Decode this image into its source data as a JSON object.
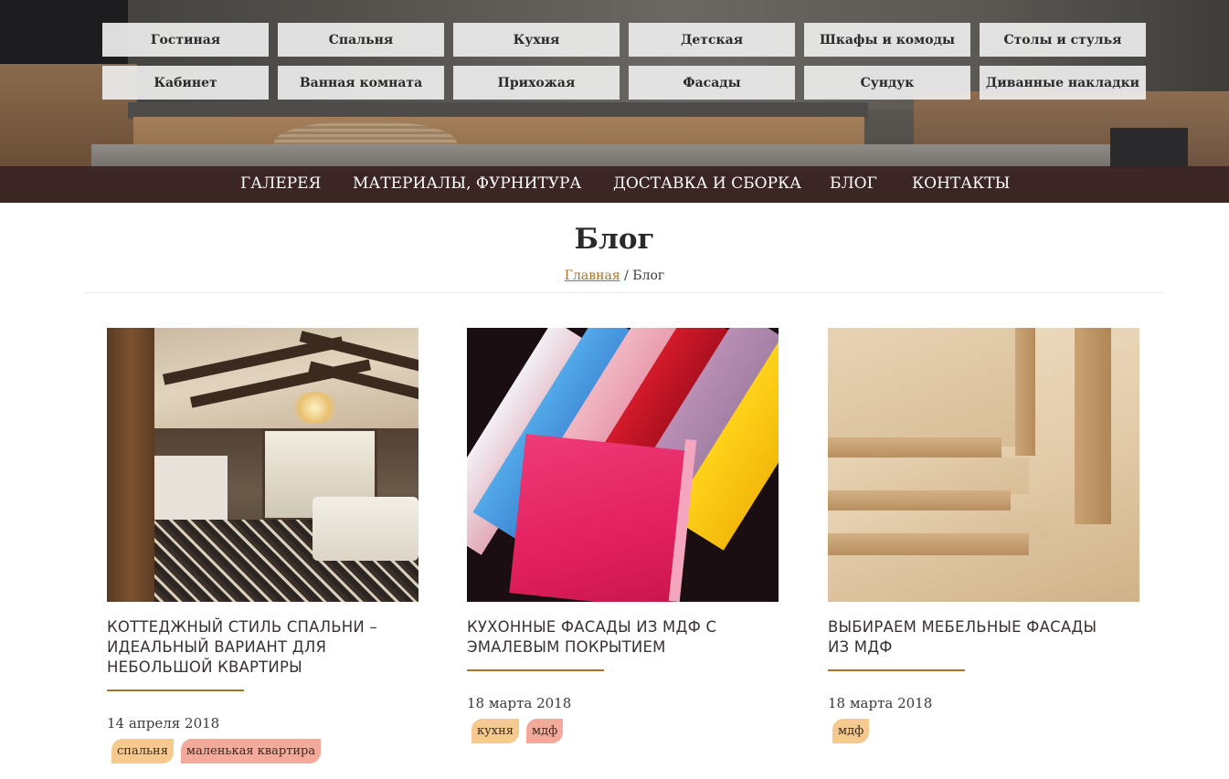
{
  "categories": [
    "Гостиная",
    "Спальня",
    "Кухня",
    "Детская",
    "Шкафы и комоды",
    "Столы и стулья",
    "Кабинет",
    "Ванная комната",
    "Прихожая",
    "Фасады",
    "Сундук",
    "Диванные накладки"
  ],
  "main_nav": [
    "ГАЛЕРЕЯ",
    "МАТЕРИАЛЫ, ФУРНИТУРА",
    "ДОСТАВКА И СБОРКА",
    "БЛОГ",
    "КОНТАКТЫ"
  ],
  "page": {
    "title": "Блог",
    "breadcrumb": {
      "home": "Главная",
      "separator": "/",
      "current": "Блог"
    }
  },
  "posts": [
    {
      "title": "КОТТЕДЖНЫЙ СТИЛЬ СПАЛЬНИ – ИДЕАЛЬНЫЙ ВАРИАНТ ДЛЯ НЕБОЛЬШОЙ КВАРТИРЫ",
      "date": "14 апреля 2018",
      "tags": [
        "спальня",
        "маленькая квартира"
      ]
    },
    {
      "title": "КУХОННЫЕ ФАСАДЫ ИЗ МДФ С ЭМАЛЕВЫМ ПОКРЫТИЕМ",
      "date": "18 марта 2018",
      "tags": [
        "кухня",
        "мдф"
      ]
    },
    {
      "title": "ВЫБИРАЕМ МЕБЕЛЬНЫЕ ФАСАДЫ ИЗ МДФ",
      "date": "18 марта 2018",
      "tags": [
        "мдф"
      ]
    }
  ],
  "colors": {
    "accent": "#a67424",
    "nav_bg": "#3a2422",
    "tag_orange": "#f6c98e",
    "tag_pink": "#f4aa9a"
  }
}
